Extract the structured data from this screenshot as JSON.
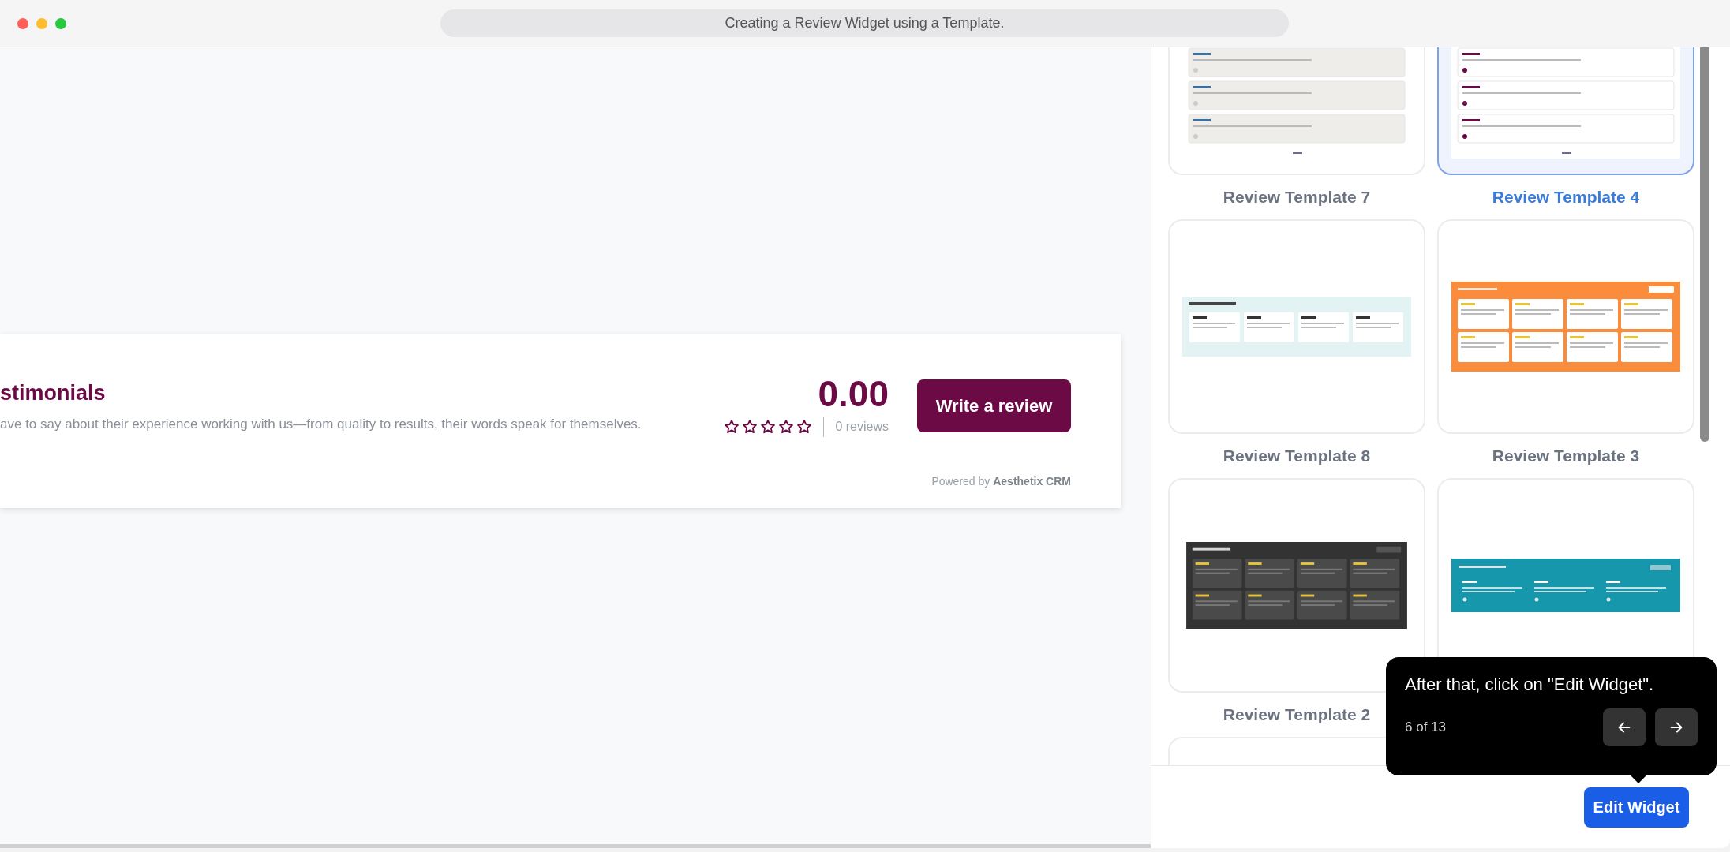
{
  "window": {
    "title": "Creating a Review Widget using a Template."
  },
  "widget": {
    "title": "stimonials",
    "subtitle": "ave to say about their experience working with us—from quality to results, their words speak for themselves.",
    "rating": "0.00",
    "stars": 0,
    "review_count": "0 reviews",
    "button": "Write a review",
    "footer": "Powered by **Aesthetix CRM**"
  },
  "templates": [
    {
      "label": "Review Template 7",
      "selected": false,
      "preview": {
        "kind": "list",
        "color": "#efedea"
      }
    },
    {
      "label": "Review Template 4",
      "selected": true,
      "preview": {
        "kind": "list",
        "color": "#ffffff"
      }
    },
    {
      "label": "Review Template 8",
      "selected": false,
      "preview": {
        "kind": "strip",
        "color": "#e3f3f3"
      }
    },
    {
      "label": "Review Template 3",
      "selected": false,
      "preview": {
        "kind": "grid",
        "color": "#fb8c3c"
      }
    },
    {
      "label": "Review Template 2",
      "selected": false,
      "preview": {
        "kind": "grid-dark",
        "color": "#333333"
      }
    },
    {
      "selected": false,
      "preview": {
        "kind": "carousel",
        "color": "#1797ab"
      }
    },
    {
      "selected": false
    }
  ],
  "tooltip": {
    "text": "After that, click on \"Edit Widget\".",
    "step": "6 of 13"
  },
  "edit_button": "Edit Widget"
}
